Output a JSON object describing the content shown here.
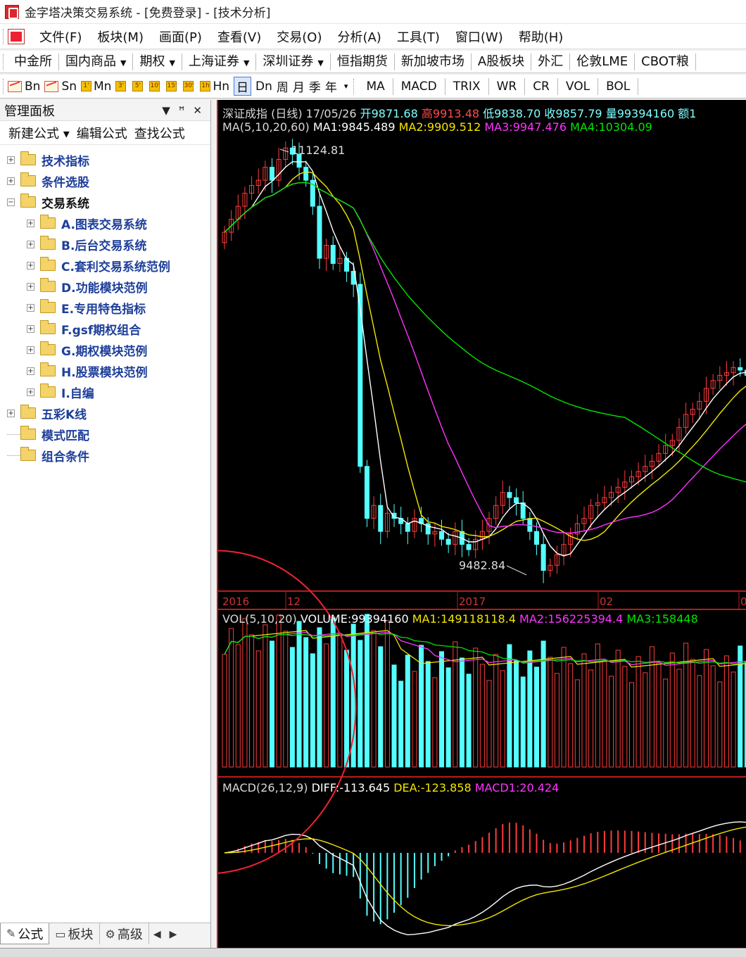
{
  "window": {
    "title": "金字塔决策交易系统 - [免费登录] - [技术分析]"
  },
  "menu": [
    {
      "label": "文件(F)"
    },
    {
      "label": "板块(M)"
    },
    {
      "label": "画面(P)"
    },
    {
      "label": "查看(V)"
    },
    {
      "label": "交易(O)"
    },
    {
      "label": "分析(A)"
    },
    {
      "label": "工具(T)"
    },
    {
      "label": "窗口(W)"
    },
    {
      "label": "帮助(H)"
    }
  ],
  "markets": [
    {
      "label": "中金所",
      "dropdown": false
    },
    {
      "label": "国内商品",
      "dropdown": true
    },
    {
      "label": "期权",
      "dropdown": true
    },
    {
      "label": "上海证券",
      "dropdown": true
    },
    {
      "label": "深圳证券",
      "dropdown": true
    },
    {
      "label": "恒指期货",
      "dropdown": false
    },
    {
      "label": "新加坡市场",
      "dropdown": false
    },
    {
      "label": "A股板块",
      "dropdown": false
    },
    {
      "label": "外汇",
      "dropdown": false
    },
    {
      "label": "伦敦LME",
      "dropdown": false
    },
    {
      "label": "CBOT粮",
      "dropdown": false
    }
  ],
  "periods": [
    {
      "icon": "chart",
      "label": "Bn"
    },
    {
      "icon": "chart",
      "label": "Sn"
    },
    {
      "icon": "1'",
      "label": "Mn"
    },
    {
      "icon": "3'",
      "label": ""
    },
    {
      "icon": "5'",
      "label": ""
    },
    {
      "icon": "10'",
      "label": ""
    },
    {
      "icon": "15'",
      "label": ""
    },
    {
      "icon": "30'",
      "label": ""
    },
    {
      "icon": "1h",
      "label": "Hn"
    },
    {
      "icon": "",
      "label": "日",
      "active": true
    },
    {
      "icon": "",
      "label": "Dn"
    },
    {
      "icon": "",
      "label": "周"
    },
    {
      "icon": "",
      "label": "月"
    },
    {
      "icon": "",
      "label": "季"
    },
    {
      "icon": "",
      "label": "年"
    }
  ],
  "indicators": [
    "MA",
    "MACD",
    "TRIX",
    "WR",
    "CR",
    "VOL",
    "BOL"
  ],
  "panel": {
    "title": "管理面板",
    "actions": [
      "新建公式 ▾",
      "编辑公式",
      "查找公式"
    ],
    "tree": [
      {
        "label": "技术指标",
        "level": 0,
        "expander": "+"
      },
      {
        "label": "条件选股",
        "level": 0,
        "expander": "+"
      },
      {
        "label": "交易系统",
        "level": 0,
        "expander": "−",
        "open": true
      },
      {
        "label": "A.图表交易系统",
        "level": 1,
        "expander": "+"
      },
      {
        "label": "B.后台交易系统",
        "level": 1,
        "expander": "+"
      },
      {
        "label": "C.套利交易系统范例",
        "level": 1,
        "expander": "+"
      },
      {
        "label": "D.功能模块范例",
        "level": 1,
        "expander": "+"
      },
      {
        "label": "E.专用特色指标",
        "level": 1,
        "expander": "+"
      },
      {
        "label": "F.gsf期权组合",
        "level": 1,
        "expander": "+"
      },
      {
        "label": "G.期权模块范例",
        "level": 1,
        "expander": "+"
      },
      {
        "label": "H.股票模块范例",
        "level": 1,
        "expander": "+"
      },
      {
        "label": "I.自编",
        "level": 1,
        "expander": "+"
      },
      {
        "label": "五彩K线",
        "level": 0,
        "expander": "+"
      },
      {
        "label": "模式匹配",
        "level": 0,
        "expander": ""
      },
      {
        "label": "组合条件",
        "level": 0,
        "expander": ""
      }
    ],
    "bottom_tabs": [
      "公式",
      "板块",
      "高级"
    ]
  },
  "chart": {
    "info_line": {
      "name": "深证成指 (日线) 17/05/26",
      "open": "开9871.68",
      "high": "高9913.48",
      "low": "低9838.70",
      "close": "收9857.79",
      "vol": "量99394160 额1"
    },
    "ma_line": {
      "name": "MA(5,10,20,60)",
      "ma1": "MA1:9845.489",
      "ma2": "MA2:9909.512",
      "ma3": "MA3:9947.476",
      "ma4": "MA4:10304.09"
    },
    "high_label": "11124.81",
    "low_label": "9482.84",
    "dates": [
      "2016",
      "12",
      "2017",
      "02",
      "0"
    ],
    "vol_line": {
      "name": "VOL(5,10,20)",
      "volume": "VOLUME:99394160",
      "ma1": "MA1:149118118.4",
      "ma2": "MA2:156225394.4",
      "ma3": "MA3:158448"
    },
    "macd_line": {
      "name": "MACD(26,12,9)",
      "diff": "DIFF:-113.645",
      "dea": "DEA:-123.858",
      "macd1": "MACD1:20.424"
    },
    "colors": {
      "up": "#ff3c3c",
      "down": "#54ffff",
      "ma1": "#ffffff",
      "ma2": "#f2e600",
      "ma3": "#ff33ff",
      "ma4": "#00e600",
      "border": "#b41e1e"
    }
  }
}
